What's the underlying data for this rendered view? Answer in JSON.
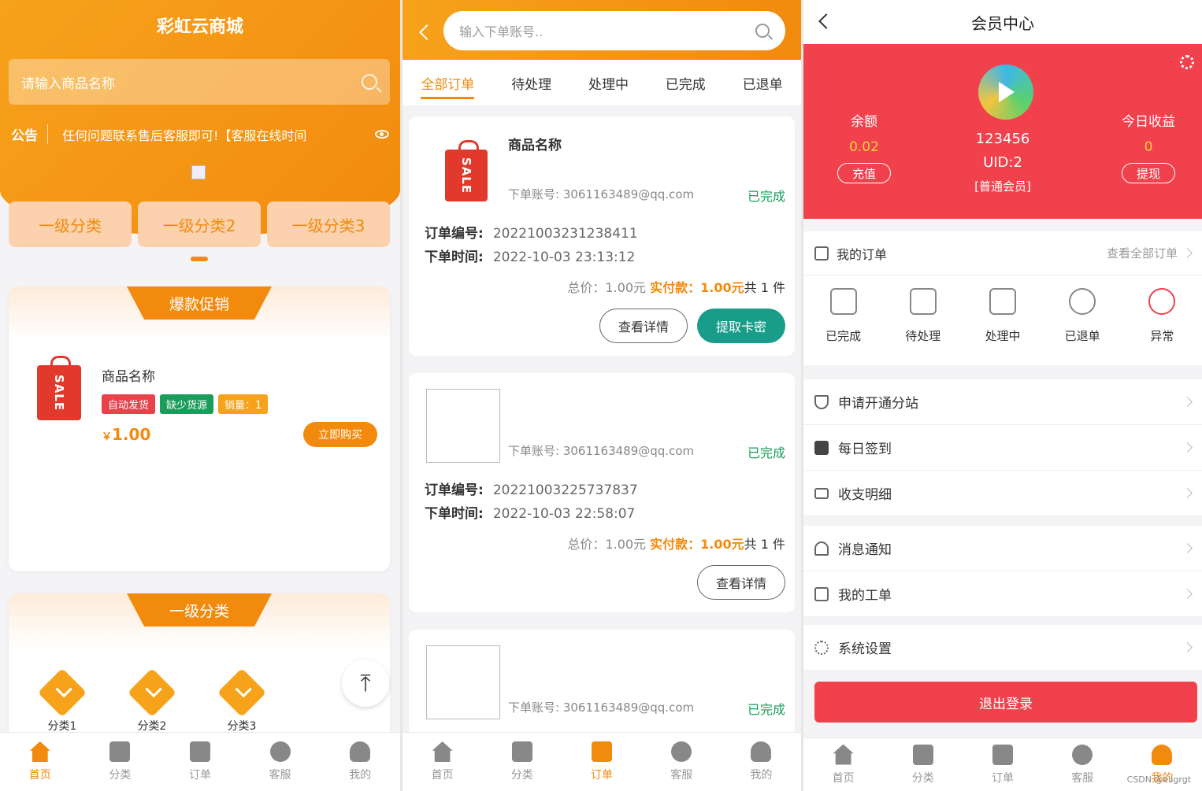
{
  "home": {
    "title": "彩虹云商城",
    "search_placeholder": "请输入商品名称",
    "notice_label": "公告",
    "notice_text": "任何问题联系售后客服即可!【客服在线时间",
    "categories": [
      "一级分类",
      "一级分类2",
      "一级分类3"
    ],
    "promo_title": "爆款促销",
    "product": {
      "name": "商品名称",
      "tags": [
        "自动发货",
        "缺少货源",
        "销量：1"
      ],
      "price_symbol": "￥",
      "price": "1.00",
      "buy_label": "立即购买",
      "bag_text": "SALE"
    },
    "category_title": "一级分类",
    "sub_categories": [
      "分类1",
      "分类2",
      "分类3"
    ],
    "to_top_icon": "arrow-up-icon"
  },
  "tabbar": [
    "首页",
    "分类",
    "订单",
    "客服",
    "我的"
  ],
  "orders": {
    "search_placeholder": "输入下单账号..",
    "tabs": [
      "全部订单",
      "待处理",
      "处理中",
      "已完成",
      "已退单"
    ],
    "labels": {
      "order_no": "订单编号:",
      "order_time": "下单时间:",
      "account_prefix": "下单账号:",
      "detail_btn": "查看详情",
      "get_code_btn": "提取卡密",
      "total": "总价：1.00元",
      "paid": "实付款：1.00元",
      "count": "共 1 件"
    },
    "items": [
      {
        "name": "商品名称",
        "account": "下单账号: 3061163489@qq.com",
        "status": "已完成",
        "no": "2022100323123841​1",
        "time": "2022-10-03 23:13:12"
      },
      {
        "name": "",
        "account": "下单账号: 3061163489@qq.com",
        "status": "已完成",
        "no": "20221003225737837",
        "time": "2022-10-03 22:58:07"
      },
      {
        "name": "",
        "account": "下单账号: 3061163489@qq.com",
        "status": "已完成"
      }
    ]
  },
  "member": {
    "title": "会员中心",
    "balance_label": "余额",
    "balance": "0.02",
    "recharge_btn": "充值",
    "today_label": "今日收益",
    "today": "0",
    "withdraw_btn": "提现",
    "username": "123456",
    "uid": "UID:2",
    "level": "[普通会员]",
    "my_orders": "我的订单",
    "view_all": "查看全部订单",
    "order_status": [
      "已完成",
      "待处理",
      "处理中",
      "已退单",
      "异常"
    ],
    "menu": [
      "申请开通分站",
      "每日签到",
      "收支明细",
      "消息通知",
      "我的工单",
      "系统设置"
    ],
    "logout": "退出登录",
    "watermark": "CSDN @eligrgt"
  }
}
